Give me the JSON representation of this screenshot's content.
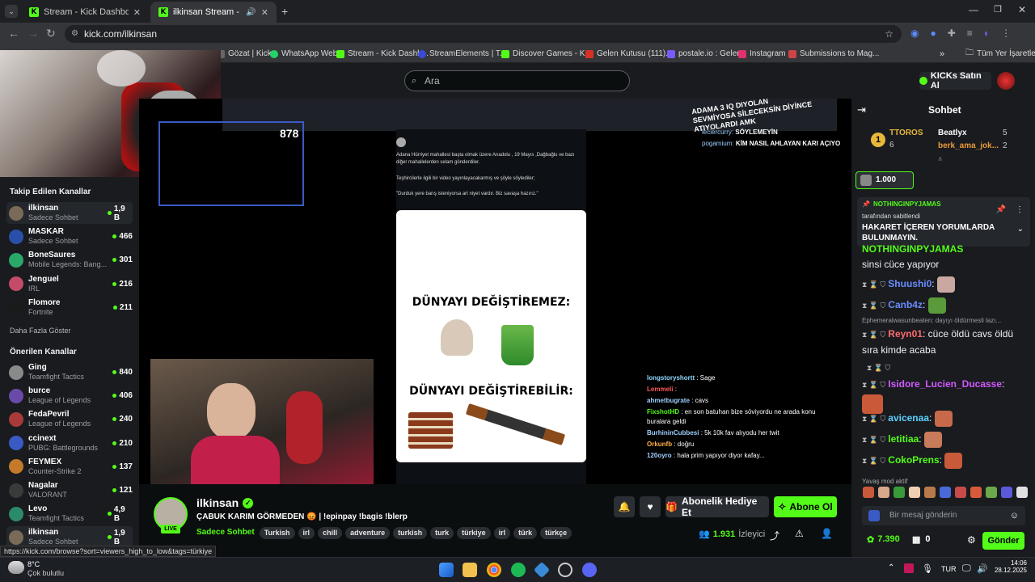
{
  "browser": {
    "tabs": [
      {
        "title": "Stream - Kick Dashboard",
        "active": false
      },
      {
        "title": "ilkinsan Stream - Watch Live",
        "active": true
      }
    ],
    "url": "kick.com/ilkinsan",
    "bookmarks": [
      "Gözat | Kick",
      "WhatsApp Web",
      "Stream - Kick Dashb...",
      "StreamElements | T...",
      "Discover Games - K...",
      "Gelen Kutusu (111)...",
      "postale.io : Gelen",
      "Instagram",
      "Submissions to Mag..."
    ],
    "all_bookmarks": "Tüm Yer İşaretleri",
    "status_url": "https://kick.com/browse?sort=viewers_high_to_low&tags=türkiye"
  },
  "header": {
    "search_placeholder": "Ara",
    "kicks_label": "KICKs Satın Al"
  },
  "sidebar": {
    "followed_title": "Takip Edilen Kanallar",
    "followed": [
      {
        "name": "ilkinsan",
        "game": "Sadece Sohbet",
        "viewers": "1,9 B",
        "color": "#7a6a58"
      },
      {
        "name": "MASKAR",
        "game": "Sadece Sohbet",
        "viewers": "466",
        "color": "#2a4fa8"
      },
      {
        "name": "BoneSaures",
        "game": "Mobile Legends: Bang...",
        "viewers": "301",
        "color": "#2aa86a"
      },
      {
        "name": "Jenguel",
        "game": "IRL",
        "viewers": "216",
        "color": "#c44a6a"
      },
      {
        "name": "Flomore",
        "game": "Fortnite",
        "viewers": "211",
        "color": "#1a1a1a"
      }
    ],
    "show_more": "Daha Fazla Göster",
    "recommended_title": "Önerilen Kanallar",
    "recommended": [
      {
        "name": "Ging",
        "game": "Teamfight Tactics",
        "viewers": "840",
        "color": "#8a8a8a"
      },
      {
        "name": "burce",
        "game": "League of Legends",
        "viewers": "406",
        "color": "#6a4aa8"
      },
      {
        "name": "FedaPevril",
        "game": "League of Legends",
        "viewers": "240",
        "color": "#a83a3a"
      },
      {
        "name": "ccinext",
        "game": "PUBG: Battlegrounds",
        "viewers": "210",
        "color": "#3a5ac4"
      },
      {
        "name": "FEYMEX",
        "game": "Counter-Strike 2",
        "viewers": "137",
        "color": "#c47a2a"
      },
      {
        "name": "Nagalar",
        "game": "VALORANT",
        "viewers": "121",
        "color": "#3a3a3a"
      },
      {
        "name": "Levo",
        "game": "Teamfight Tactics",
        "viewers": "4,9 B",
        "color": "#2a8a6a"
      },
      {
        "name": "ilkinsan",
        "game": "Sadece Sohbet",
        "viewers": "1,9 B",
        "color": "#7a6a58"
      }
    ]
  },
  "player": {
    "overlay_counter": "878",
    "meme_top": "DÜNYAYI DEĞİŞTİREMEZ:",
    "meme_bottom": "DÜNYAYI DEĞİŞTİREBİLİR:",
    "tweet_text_1": "Adana Hürriyet mahallesi başta olmak üzere Anadolu , 19 Mayıs ,Dağbağlu ve bazı diğer mahallelerden selam gönderdiler.",
    "tweet_text_2": "Teşhircilerle ilgili bir video yayınlayacakarmış ve şöyle söylediler;",
    "tweet_text_3": "\"Durduk yere barış isteniyorsa art niyet vardır. Biz savaşa hazırız.\"",
    "overlay_top_1": "ADAMA 3 IQ DIYOLAN",
    "overlay_top_2": "SEVMİYOSA SİLECEKSİN DİYİNCE",
    "overlay_top_3": "ATIYOLARDI AMK",
    "overlay_chat": [
      {
        "user": "leciercurry:",
        "msg": "SÖYLEMEYİN"
      },
      {
        "user": "pogamium:",
        "msg": "KİM NASIL AHLAYAN KARI AÇIYO"
      }
    ],
    "chat_overlay": [
      {
        "user": "longstoryshortt",
        "msg": ": Sage",
        "color": "#8fd8ff"
      },
      {
        "user": "Lemmeli",
        "msg": ":",
        "color": "#ff5a5a"
      },
      {
        "user": "ahmetbugrate",
        "msg": ": cavs",
        "color": "#9fd0ff"
      },
      {
        "user": "FixshotHD",
        "msg": ": en son batuhan bize söviyordu ne arada konu buralara geldi",
        "color": "#53fc18"
      },
      {
        "user": "BurhininCubbesi",
        "msg": ": 5k 10k fav alıyodu her twit",
        "color": "#9fd0ff"
      },
      {
        "user": "Orkunfb",
        "msg": ": doğru",
        "color": "#ffb04a"
      },
      {
        "user": "120oyro",
        "msg": ": hala prim yapıyor diyor kafay...",
        "color": "#9fd0ff"
      }
    ]
  },
  "stream": {
    "channel": "ilkinsan",
    "live_badge": "LIVE",
    "title": "ÇABUK KARIM GÖRMEDEN 😡 | !epinpay !bagis !blerp",
    "category": "Sadece Sohbet",
    "tags": [
      "Turkish",
      "irl",
      "chill",
      "adventure",
      "turkish",
      "turk",
      "türkiye",
      "irl",
      "türk",
      "türkçe"
    ],
    "gift_label": "Abonelik Hediye Et",
    "subscribe_label": "Abone Ol",
    "viewers": "1.931",
    "viewers_label": "İzleyici"
  },
  "chat": {
    "title": "Sohbet",
    "top_gifters": [
      {
        "name": "TTOROS",
        "count": "6"
      },
      {
        "name": "Beatlyx",
        "count": "5"
      },
      {
        "name": "berk_ama_jok...",
        "count": "2"
      }
    ],
    "rank_badge": "1",
    "kick_goal": "1.000",
    "pinned_user": "NOTHINGINPYJAMAS",
    "pinned_by": "tarafından sabitlendi",
    "pinned_text": "HAKARET İÇEREN YORUMLARDA BULUNMAYIN.",
    "messages": [
      {
        "user": "NOTHINGINPYJAMAS",
        "text": "sinsi cüce yapıyor",
        "color": "#53fc18"
      },
      {
        "user": "Shuushi0",
        "text": "",
        "color": "#6a8cff"
      },
      {
        "user": "Canb4z",
        "text": "",
        "color": "#6a8cff"
      },
      {
        "user": "Reyn01",
        "text": "cüce öldü cavs öldü sıra kimde acaba",
        "color": "#ff6a6a"
      },
      {
        "user": "Isidore_Lucien_Ducasse",
        "text": "",
        "color": "#d05aff"
      },
      {
        "user": "avicenaa",
        "text": "",
        "color": "#5ad0ff"
      },
      {
        "user": "letitiaa",
        "text": "",
        "color": "#53fc18"
      },
      {
        "user": "CokoPrens",
        "text": "",
        "color": "#53fc18"
      }
    ],
    "reply_hint": "Ephemeralwasunbeaten: dayıyı öldürmesli lazı...",
    "slow_mode": "Yavaş mod aktif",
    "input_placeholder": "Bir mesaj gönderin",
    "points": "7.390",
    "inventory": "0",
    "send_label": "Gönder"
  },
  "taskbar": {
    "temperature": "8°C",
    "weather": "Çok bulutlu",
    "lang": "TUR",
    "time": "14:06",
    "date": "28.12.2025"
  }
}
